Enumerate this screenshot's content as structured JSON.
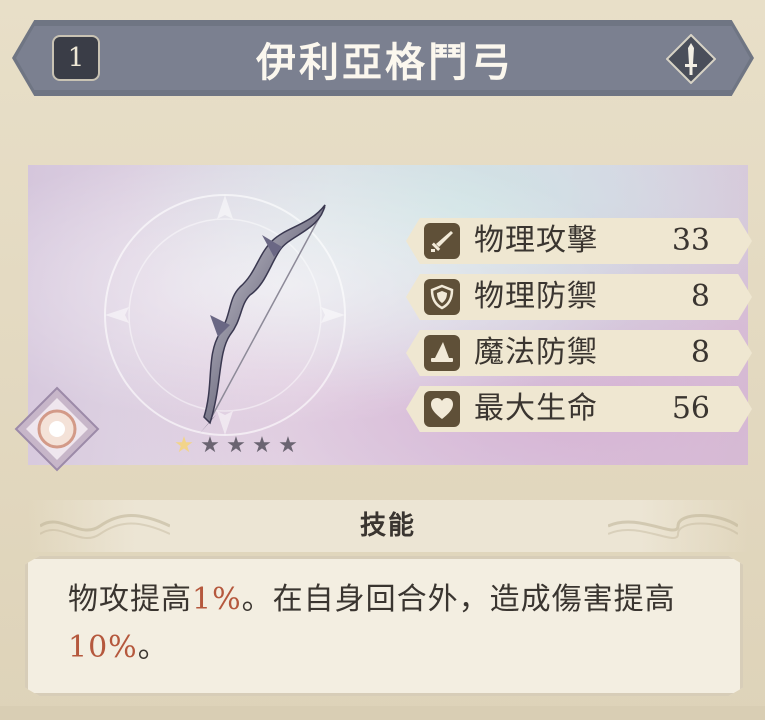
{
  "item": {
    "rank": "1",
    "name": "伊利亞格鬥弓",
    "rarity": {
      "filled": 1,
      "total": 5
    }
  },
  "stats": [
    {
      "icon": "sword-icon",
      "label": "物理攻擊",
      "value": "33"
    },
    {
      "icon": "shield-icon",
      "label": "物理防禦",
      "value": "8"
    },
    {
      "icon": "wizard-hat-icon",
      "label": "魔法防禦",
      "value": "8"
    },
    {
      "icon": "heart-icon",
      "label": "最大生命",
      "value": "56"
    }
  ],
  "skill": {
    "title": "技能",
    "desc_part1": "物攻提高",
    "desc_hl1": "1%",
    "desc_part2": "。在自身回合外，造成傷害提高",
    "desc_hl2": "10%",
    "desc_part3": "。"
  },
  "colors": {
    "banner": "#7b8090",
    "stat_icon_bg": "#5f5038",
    "highlight": "#b5583d",
    "star_on": "#f2d48a",
    "star_off": "#6a6471"
  }
}
